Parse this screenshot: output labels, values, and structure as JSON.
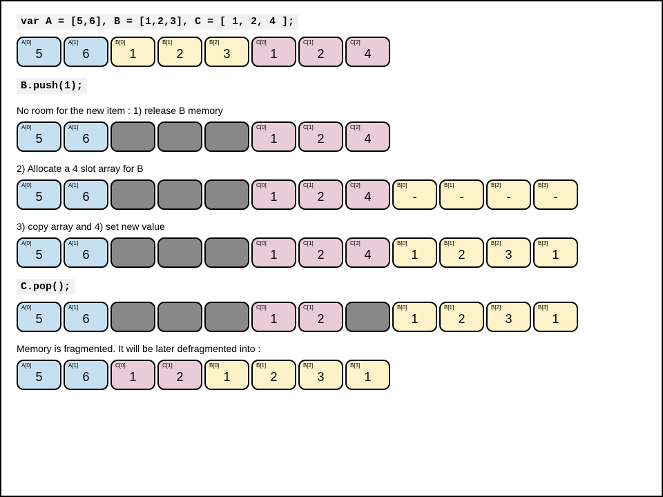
{
  "lines": {
    "decl": "var A = [5,6],  B = [1,2,3], C = [ 1, 2, 4 ];",
    "push": "B.push(1);",
    "cap1": "No room for the new item : 1) release B memory",
    "cap2": "2) Allocate a 4 slot array for B",
    "cap3": "3) copy array and 4) set new value",
    "pop": "C.pop();",
    "cap4": "Memory is fragmented. It will be later defragmented into :"
  },
  "rows": {
    "r1": [
      {
        "c": "blue",
        "l": "A[0]",
        "v": "5"
      },
      {
        "c": "blue",
        "l": "A[1]",
        "v": "6"
      },
      {
        "c": "yellow",
        "l": "B[0]",
        "v": "1"
      },
      {
        "c": "yellow",
        "l": "B[1]",
        "v": "2"
      },
      {
        "c": "yellow",
        "l": "B[2]",
        "v": "3"
      },
      {
        "c": "pink",
        "l": "C[0]",
        "v": "1"
      },
      {
        "c": "pink",
        "l": "C[1]",
        "v": "2"
      },
      {
        "c": "pink",
        "l": "C[2]",
        "v": "4"
      }
    ],
    "r2": [
      {
        "c": "blue",
        "l": "A[0]",
        "v": "5"
      },
      {
        "c": "blue",
        "l": "A[1]",
        "v": "6"
      },
      {
        "c": "gray",
        "l": "",
        "v": ""
      },
      {
        "c": "gray",
        "l": "",
        "v": ""
      },
      {
        "c": "gray",
        "l": "",
        "v": ""
      },
      {
        "c": "pink",
        "l": "C[0]",
        "v": "1"
      },
      {
        "c": "pink",
        "l": "C[1]",
        "v": "2"
      },
      {
        "c": "pink",
        "l": "C[2]",
        "v": "4"
      }
    ],
    "r3": [
      {
        "c": "blue",
        "l": "A[0]",
        "v": "5"
      },
      {
        "c": "blue",
        "l": "A[1]",
        "v": "6"
      },
      {
        "c": "gray",
        "l": "",
        "v": ""
      },
      {
        "c": "gray",
        "l": "",
        "v": ""
      },
      {
        "c": "gray",
        "l": "",
        "v": ""
      },
      {
        "c": "pink",
        "l": "C[0]",
        "v": "1"
      },
      {
        "c": "pink",
        "l": "C[1]",
        "v": "2"
      },
      {
        "c": "pink",
        "l": "C[2]",
        "v": "4"
      },
      {
        "c": "yellow",
        "l": "B[0]",
        "v": "-"
      },
      {
        "c": "yellow",
        "l": "B[1]",
        "v": "-"
      },
      {
        "c": "yellow",
        "l": "B[2]",
        "v": "-"
      },
      {
        "c": "yellow",
        "l": "B[3]",
        "v": "-"
      }
    ],
    "r4": [
      {
        "c": "blue",
        "l": "A[0]",
        "v": "5"
      },
      {
        "c": "blue",
        "l": "A[1]",
        "v": "6"
      },
      {
        "c": "gray",
        "l": "",
        "v": ""
      },
      {
        "c": "gray",
        "l": "",
        "v": ""
      },
      {
        "c": "gray",
        "l": "",
        "v": ""
      },
      {
        "c": "pink",
        "l": "C[0]",
        "v": "1"
      },
      {
        "c": "pink",
        "l": "C[1]",
        "v": "2"
      },
      {
        "c": "pink",
        "l": "C[2]",
        "v": "4"
      },
      {
        "c": "yellow",
        "l": "B[0]",
        "v": "1"
      },
      {
        "c": "yellow",
        "l": "B[1]",
        "v": "2"
      },
      {
        "c": "yellow",
        "l": "B[2]",
        "v": "3"
      },
      {
        "c": "yellow",
        "l": "B[3]",
        "v": "1"
      }
    ],
    "r5": [
      {
        "c": "blue",
        "l": "A[0]",
        "v": "5"
      },
      {
        "c": "blue",
        "l": "A[1]",
        "v": "6"
      },
      {
        "c": "gray",
        "l": "",
        "v": ""
      },
      {
        "c": "gray",
        "l": "",
        "v": ""
      },
      {
        "c": "gray",
        "l": "",
        "v": ""
      },
      {
        "c": "pink",
        "l": "C[0]",
        "v": "1"
      },
      {
        "c": "pink",
        "l": "C[1]",
        "v": "2"
      },
      {
        "c": "gray",
        "l": "",
        "v": ""
      },
      {
        "c": "yellow",
        "l": "B[0]",
        "v": "1"
      },
      {
        "c": "yellow",
        "l": "B[1]",
        "v": "2"
      },
      {
        "c": "yellow",
        "l": "B[2]",
        "v": "3"
      },
      {
        "c": "yellow",
        "l": "B[3]",
        "v": "1"
      }
    ],
    "r6": [
      {
        "c": "blue",
        "l": "A[0]",
        "v": "5"
      },
      {
        "c": "blue",
        "l": "A[1]",
        "v": "6"
      },
      {
        "c": "pink",
        "l": "C[0]",
        "v": "1"
      },
      {
        "c": "pink",
        "l": "C[1]",
        "v": "2"
      },
      {
        "c": "yellow",
        "l": "B[0]",
        "v": "1"
      },
      {
        "c": "yellow",
        "l": "B[1]",
        "v": "2"
      },
      {
        "c": "yellow",
        "l": "B[2]",
        "v": "3"
      },
      {
        "c": "yellow",
        "l": "B[3]",
        "v": "1"
      }
    ]
  }
}
